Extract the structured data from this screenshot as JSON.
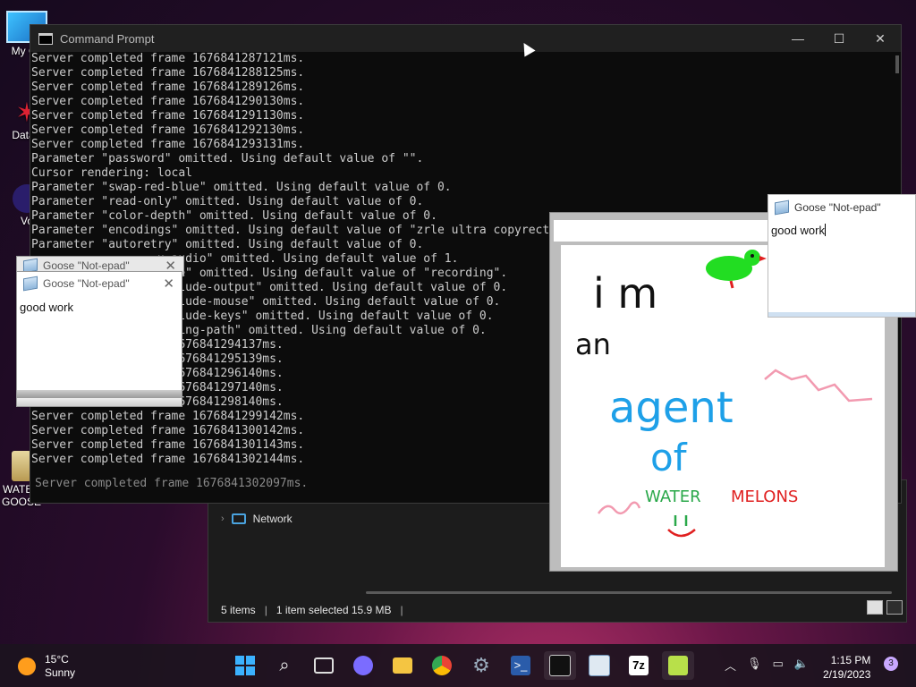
{
  "desktop": {
    "icons": [
      {
        "label": "My Co"
      },
      {
        "label": "DataV"
      },
      {
        "label": "Vo"
      },
      {
        "label": "WATER GOOSE"
      }
    ]
  },
  "cmd": {
    "title": "Command Prompt",
    "lines": [
      "Server completed frame 1676841287121ms.",
      "Server completed frame 1676841288125ms.",
      "Server completed frame 1676841289126ms.",
      "Server completed frame 1676841290130ms.",
      "Server completed frame 1676841291130ms.",
      "Server completed frame 1676841292130ms.",
      "Server completed frame 1676841293131ms.",
      "Parameter \"password\" omitted. Using default value of \"\".",
      "Cursor rendering: local",
      "Parameter \"swap-red-blue\" omitted. Using default value of 0.",
      "Parameter \"read-only\" omitted. Using default value of 0.",
      "Parameter \"color-depth\" omitted. Using default value of 0.",
      "Parameter \"encodings\" omitted. Using default value of \"zrle ultra copyrect",
      "Parameter \"autoretry\" omitted. Using default value of 0.",
      "                  u-audio\" omitted. Using default value of 1.",
      "                  name\" omitted. Using default value of \"recording\".",
      "                  exclude-output\" omitted. Using default value of 0.",
      "                  exclude-mouse\" omitted. Using default value of 0.",
      "                  include-keys\" omitted. Using default value of 0.",
      "                  ording-path\" omitted. Using default value of 0.",
      "                  e 1676841294137ms.",
      "                  e 1676841295139ms.",
      "                  e 1676841296140ms.",
      "                  e 1676841297140ms.",
      "                  e 1676841298140ms.",
      "Server completed frame 1676841299142ms.",
      "Server completed frame 1676841300142ms.",
      "Server completed frame 1676841301143ms.",
      "Server completed frame 1676841302144ms."
    ],
    "ghost_line": "Server completed frame 1676841302097ms."
  },
  "notepad_left": {
    "back_title": "Goose \"Not-epad\"",
    "title": "Goose \"Not-epad\"",
    "text": "good work"
  },
  "notepad_right": {
    "title": "Goose \"Not-epad\"",
    "text": "good work"
  },
  "drawing": {
    "line1": "i m",
    "line2": "an",
    "line3": "agent",
    "line4": "of",
    "line5a": "WATER",
    "line5b": "MELONS",
    "colors": {
      "black": "#111111",
      "blue": "#1ea0e8",
      "green": "#2aa84a",
      "red": "#e02020",
      "pink": "#f29ab0",
      "goose": "#22dd22"
    }
  },
  "explorer": {
    "nav_network": "Network",
    "status_items": "5 items",
    "status_selected": "1 item selected  15.9 MB"
  },
  "taskbar": {
    "weather_temp": "15°C",
    "weather_desc": "Sunny",
    "time": "1:15 PM",
    "date": "2/19/2023",
    "notifications": "3"
  }
}
